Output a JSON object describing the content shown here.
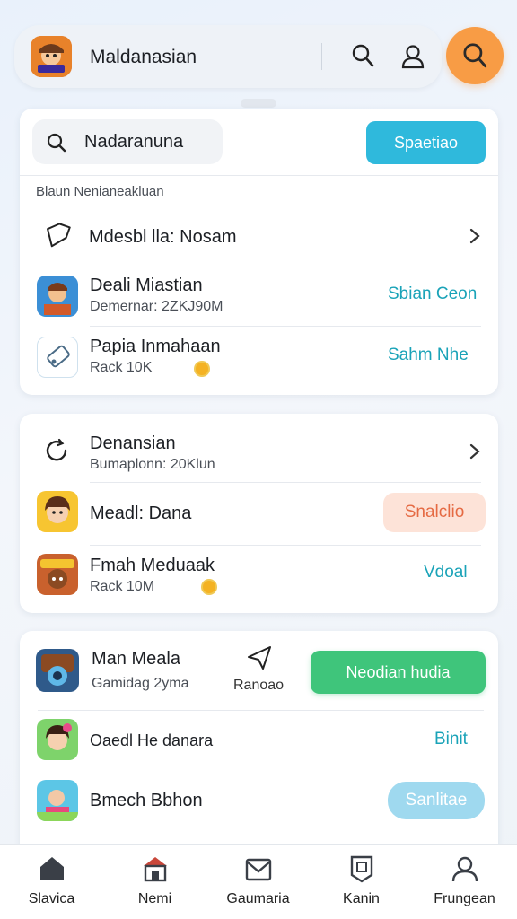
{
  "topbar": {
    "title": "Maldanasian",
    "logo_icon": "game-character-logo",
    "icons": [
      "search-icon",
      "user-icon",
      "search-icon"
    ]
  },
  "search_card": {
    "search_value": "Nadaranuna",
    "button_label": "Spaetiao",
    "section_label": "Blaun Nenianeakluan",
    "rows": [
      {
        "title": "Mdesbl lla: Nosam",
        "icon": "tag-icon",
        "action": "chevron-right-icon"
      },
      {
        "title": "Deali Miastian",
        "subtitle": "Demernar: 2ZKJ90M",
        "action": "Sbian Ceon"
      },
      {
        "title": "Papia Inmahaan",
        "subtitle": "Rack 10K",
        "action": "Sahm Nhe"
      }
    ]
  },
  "second_card": {
    "header_title": "Denansian",
    "header_sub": "Bumaplonn: 20Klun",
    "rows": [
      {
        "title": "Meadl: Dana",
        "action": "Snalclio"
      },
      {
        "title": "Fmah Meduaak",
        "subtitle": "Rack 10M",
        "action": "Vdoal"
      }
    ]
  },
  "third_card": {
    "feature_title": "Man Meala",
    "feature_sub": "Gamidag 2yma",
    "share_label": "Ranoao",
    "button_label": "Neodian hudia",
    "rows": [
      {
        "title": "Oaedl He danara",
        "action": "Binit"
      },
      {
        "title": "Bmech Bbhon",
        "action": "Sanlitae"
      }
    ]
  },
  "bottom_nav": [
    {
      "label": "Slavica",
      "icon": "home-icon"
    },
    {
      "label": "Nemi",
      "icon": "store-icon"
    },
    {
      "label": "Gaumaria",
      "icon": "mail-icon"
    },
    {
      "label": "Kanin",
      "icon": "badge-icon"
    },
    {
      "label": "Frungean",
      "icon": "profile-icon"
    }
  ],
  "colors": {
    "accent_orange": "#f89c45",
    "cyan": "#2fb9dc",
    "green": "#3fc57b",
    "action_teal": "#1aa3b8"
  }
}
